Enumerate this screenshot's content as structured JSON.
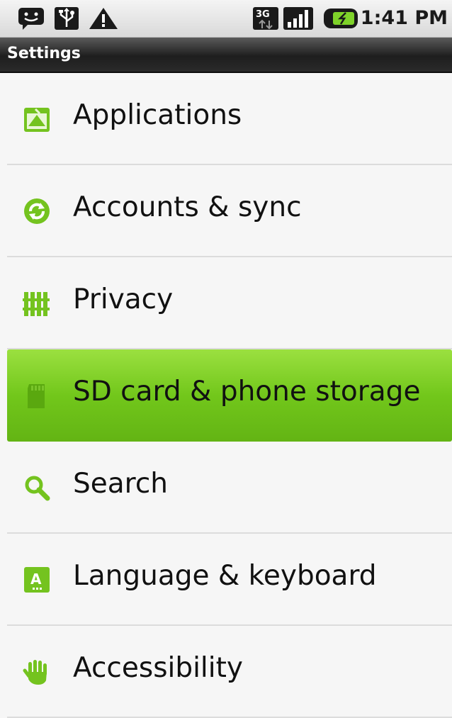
{
  "status_bar": {
    "icons": [
      "messaging-icon",
      "usb-icon",
      "warning-icon",
      "3g-data-icon",
      "signal-icon",
      "battery-charging-icon"
    ],
    "time": "1:41 PM"
  },
  "title_bar": {
    "title": "Settings"
  },
  "settings_list": {
    "items": [
      {
        "label": "Applications",
        "icon": "applications-icon",
        "selected": false
      },
      {
        "label": "Accounts & sync",
        "icon": "sync-icon",
        "selected": false
      },
      {
        "label": "Privacy",
        "icon": "fence-icon",
        "selected": false
      },
      {
        "label": "SD card & phone storage",
        "icon": "sd-card-icon",
        "selected": true
      },
      {
        "label": "Search",
        "icon": "search-icon",
        "selected": false
      },
      {
        "label": "Language & keyboard",
        "icon": "keyboard-icon",
        "selected": false
      },
      {
        "label": "Accessibility",
        "icon": "hand-icon",
        "selected": false
      }
    ]
  },
  "colors": {
    "accent_green": "#74c31f",
    "selected_highlight": "#6cbf17",
    "titlebar_bg": "#222222"
  }
}
